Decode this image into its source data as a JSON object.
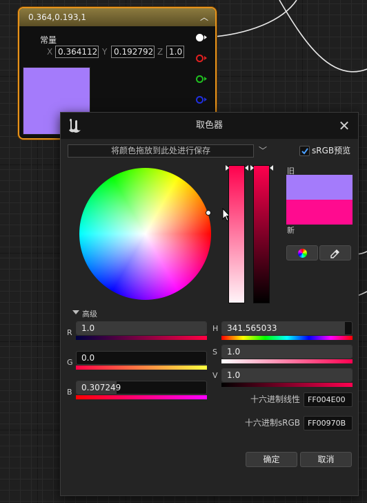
{
  "graph": {
    "node": {
      "title": "0.364,0.193,1",
      "collapse_icon": "chevron-up-icon",
      "label": "常量",
      "x_label": "X",
      "x_value": "0.364112",
      "y_label": "Y",
      "y_value": "0.192792",
      "z_label": "Z",
      "z_value": "1.0",
      "swatch_color": "#a47bfb",
      "pins": [
        {
          "name": "output-pin-white",
          "color": "#ffffff"
        },
        {
          "name": "output-pin-red",
          "color": "#e02020"
        },
        {
          "name": "output-pin-green",
          "color": "#20c020"
        },
        {
          "name": "output-pin-blue",
          "color": "#2030e0"
        }
      ]
    }
  },
  "dialog": {
    "title": "取色器",
    "logo": "unreal-logo-icon",
    "close_icon": "close-icon",
    "saved_colors_placeholder": "将颜色拖放到此处进行保存",
    "srgb_preview_label": "sRGB预览",
    "srgb_preview_checked": true,
    "old_label": "旧",
    "new_label": "新",
    "old_color": "#a47bfb",
    "new_color": "#ff0b8f",
    "wheel_button_icon": "color-wheel-icon",
    "eyedropper_icon": "eyedropper-icon",
    "advanced_label": "高级",
    "channels": {
      "r": {
        "label": "R",
        "value": "1.0",
        "fill": 1.0
      },
      "g": {
        "label": "G",
        "value": "0.0",
        "fill": 0.0
      },
      "b": {
        "label": "B",
        "value": "0.307249",
        "fill": 0.307249
      },
      "h": {
        "label": "H",
        "value": "341.565033",
        "fill": 0.9488
      },
      "s": {
        "label": "S",
        "value": "1.0",
        "fill": 1.0
      },
      "v": {
        "label": "V",
        "value": "1.0",
        "fill": 1.0
      }
    },
    "hex_linear_label": "十六进制线性",
    "hex_linear_value": "FF004E00",
    "hex_srgb_label": "十六进制sRGB",
    "hex_srgb_value": "FF00970B",
    "ok_label": "确定",
    "cancel_label": "取消"
  }
}
